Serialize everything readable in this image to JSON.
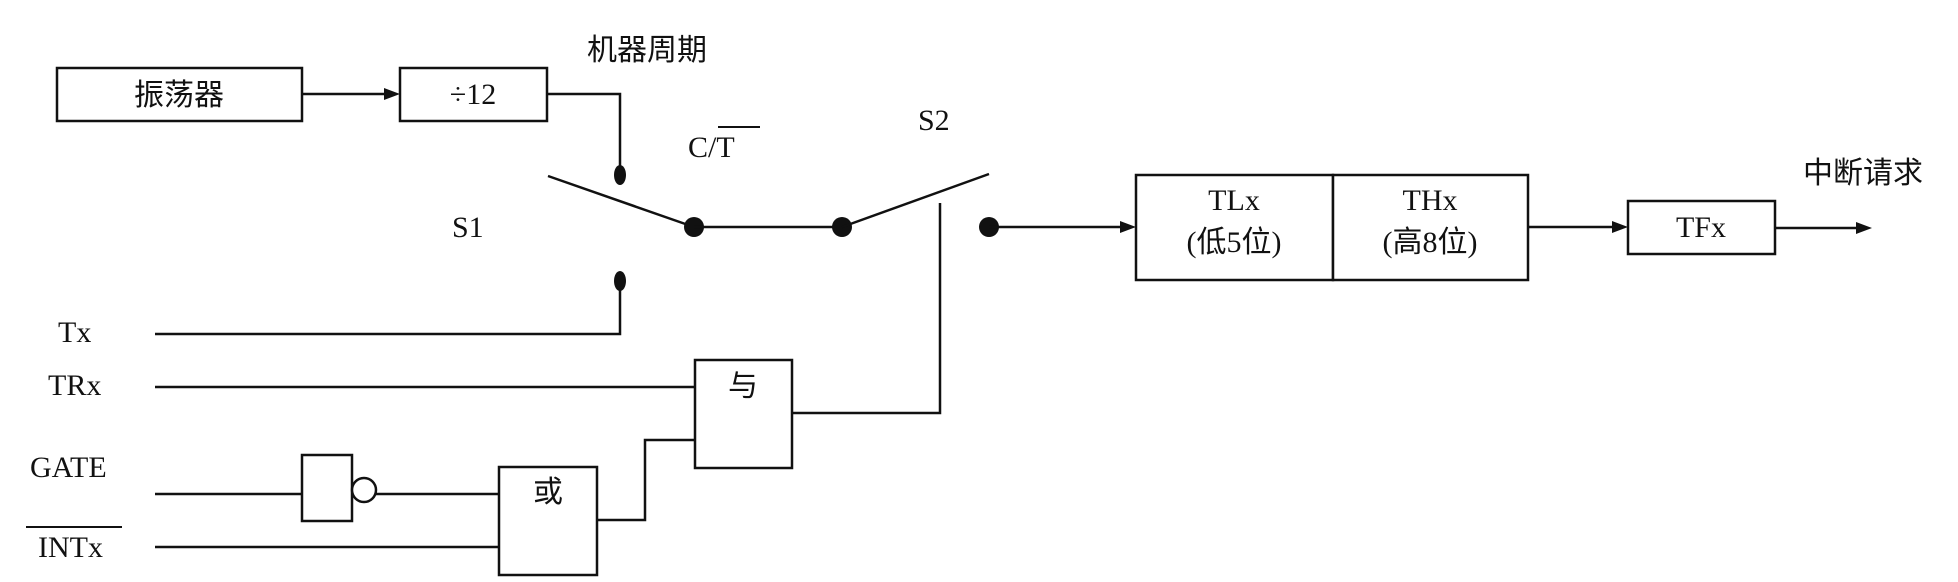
{
  "blocks": {
    "oscillator": "振荡器",
    "divider": "÷12",
    "machine_cycle": "机器周期",
    "tl_name": "TLx",
    "tl_desc": "(低5位)",
    "th_name": "THx",
    "th_desc": "(高8位)",
    "tf": "TFx",
    "interrupt": "中断请求"
  },
  "switches": {
    "s1": "S1",
    "s2": "S2",
    "ct_c": "C/",
    "ct_t": "T"
  },
  "inputs": {
    "tx": "Tx",
    "trx": "TRx",
    "gate": "GATE",
    "intx": "INTx"
  },
  "gates": {
    "and_label": "与",
    "or_label": "或"
  },
  "colors": {
    "line": "#111111",
    "background": "#ffffff"
  }
}
